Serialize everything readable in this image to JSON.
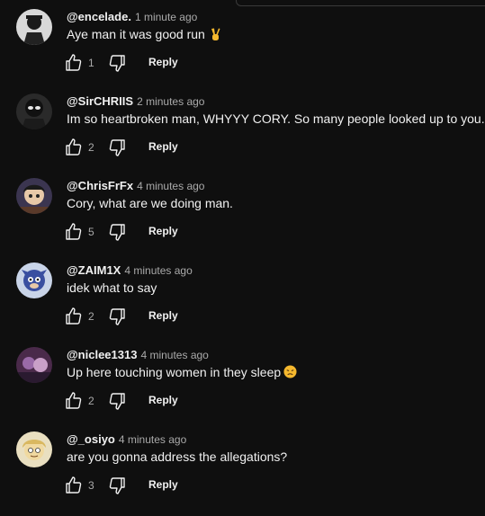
{
  "comments": [
    {
      "author": "@encelade.",
      "time": "1 minute ago",
      "text": "Aye man it was good run",
      "emoji": "victory-hand",
      "likes": "1",
      "reply": "Reply"
    },
    {
      "author": "@SirCHRIIS",
      "time": "2 minutes ago",
      "text": "Im so heartbroken man, WHYYY CORY. So many people looked up to you.",
      "emoji": "",
      "likes": "2",
      "reply": "Reply"
    },
    {
      "author": "@ChrisFrFx",
      "time": "4 minutes ago",
      "text": "Cory, what are we doing man.",
      "emoji": "",
      "likes": "5",
      "reply": "Reply"
    },
    {
      "author": "@ZAIM1X",
      "time": "4 minutes ago",
      "text": "idek what to say",
      "emoji": "",
      "likes": "2",
      "reply": "Reply"
    },
    {
      "author": "@niclee1313",
      "time": "4 minutes ago",
      "text": "Up here touching women in they sleep",
      "emoji": "persevering-face",
      "likes": "2",
      "reply": "Reply"
    },
    {
      "author": "@_osiyo",
      "time": "4 minutes ago",
      "text": "are you gonna address the allegations?",
      "emoji": "",
      "likes": "3",
      "reply": "Reply"
    }
  ],
  "icons": {
    "like": "thumbs-up-icon",
    "dislike": "thumbs-down-icon"
  },
  "colors": {
    "background": "#0f0f0f",
    "text": "#f1f1f1",
    "secondary": "#aaaaaa"
  }
}
